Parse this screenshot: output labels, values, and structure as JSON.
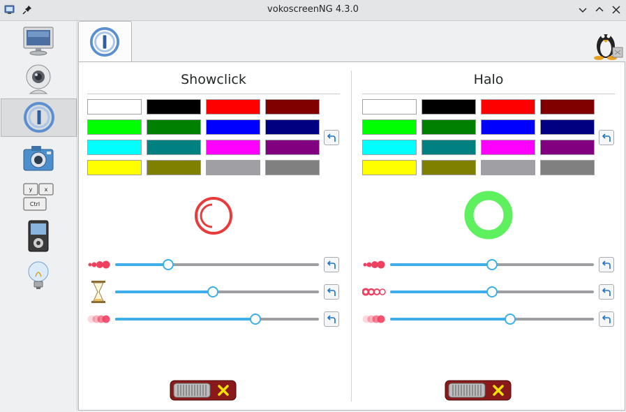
{
  "window": {
    "title": "vokoscreenNG 4.3.0",
    "controls": [
      "minimize",
      "maximize",
      "close"
    ]
  },
  "sidebar": {
    "items": [
      {
        "name": "screencast",
        "icon": "monitor-icon"
      },
      {
        "name": "camera",
        "icon": "webcam-icon"
      },
      {
        "name": "showclick",
        "icon": "showclick-icon",
        "active": true
      },
      {
        "name": "screenshot",
        "icon": "photo-camera-icon"
      },
      {
        "name": "keyboard",
        "icon": "keyboard-icon"
      },
      {
        "name": "player",
        "icon": "media-player-icon"
      },
      {
        "name": "info",
        "icon": "lightbulb-icon"
      }
    ]
  },
  "tabs": [
    {
      "name": "showclick-tab",
      "icon": "showclick-icon"
    }
  ],
  "showclick": {
    "title": "Showclick",
    "selected_color": "#e83b3b",
    "sliders": [
      {
        "name": "size",
        "icon": "dots-size-icon",
        "value": 0.26
      },
      {
        "name": "time",
        "icon": "hourglass-icon",
        "value": 0.48
      },
      {
        "name": "opacity",
        "icon": "dots-opacity-icon",
        "value": 0.69
      }
    ],
    "toggle": "off"
  },
  "halo": {
    "title": "Halo",
    "selected_color": "#5ef05e",
    "sliders": [
      {
        "name": "size",
        "icon": "dots-size-icon",
        "value": 0.5
      },
      {
        "name": "ring-width",
        "icon": "rings-icon",
        "value": 0.5
      },
      {
        "name": "opacity",
        "icon": "dots-opacity-icon",
        "value": 0.59
      }
    ],
    "toggle": "off"
  },
  "palette": [
    "#ffffff",
    "#000000",
    "#ff0000",
    "#800000",
    "#00ff00",
    "#008000",
    "#0000ff",
    "#000080",
    "#00ffff",
    "#008080",
    "#ff00ff",
    "#800080",
    "#ffff00",
    "#808000",
    "#a0a0a4",
    "#808080"
  ]
}
